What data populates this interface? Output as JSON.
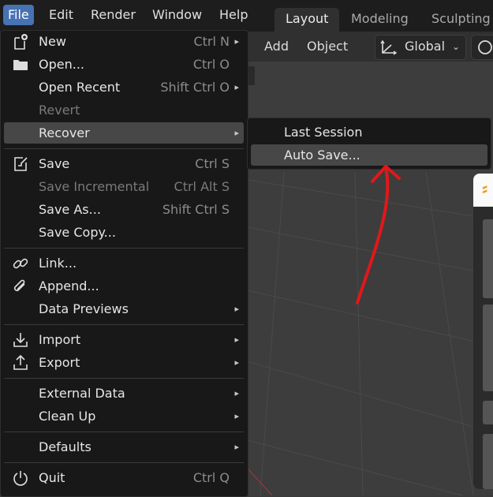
{
  "menubar": {
    "items": [
      {
        "label": "File",
        "active": true
      },
      {
        "label": "Edit"
      },
      {
        "label": "Render"
      },
      {
        "label": "Window"
      },
      {
        "label": "Help"
      }
    ]
  },
  "workspaces": [
    "Layout",
    "Modeling",
    "Sculpting"
  ],
  "header": {
    "add": "Add",
    "object": "Object",
    "orientation": "Global"
  },
  "file_menu": {
    "new": {
      "label": "New",
      "shortcut": "Ctrl N"
    },
    "open": {
      "label": "Open...",
      "shortcut": "Ctrl O"
    },
    "open_recent": {
      "label": "Open Recent",
      "shortcut": "Shift Ctrl O"
    },
    "revert": {
      "label": "Revert"
    },
    "recover": {
      "label": "Recover"
    },
    "save": {
      "label": "Save",
      "shortcut": "Ctrl S"
    },
    "save_incremental": {
      "label": "Save Incremental",
      "shortcut": "Ctrl Alt S"
    },
    "save_as": {
      "label": "Save As...",
      "shortcut": "Shift Ctrl S"
    },
    "save_copy": {
      "label": "Save Copy..."
    },
    "link": {
      "label": "Link..."
    },
    "append": {
      "label": "Append..."
    },
    "data_previews": {
      "label": "Data Previews"
    },
    "import": {
      "label": "Import"
    },
    "export": {
      "label": "Export"
    },
    "external_data": {
      "label": "External Data"
    },
    "clean_up": {
      "label": "Clean Up"
    },
    "defaults": {
      "label": "Defaults"
    },
    "quit": {
      "label": "Quit",
      "shortcut": "Ctrl Q"
    }
  },
  "recover_submenu": {
    "last_session": "Last Session",
    "auto_save": "Auto Save..."
  },
  "colors": {
    "accent": "#4772b3",
    "menu_bg": "#181818",
    "highlight": "#474747",
    "annotation": "#e0181a"
  }
}
